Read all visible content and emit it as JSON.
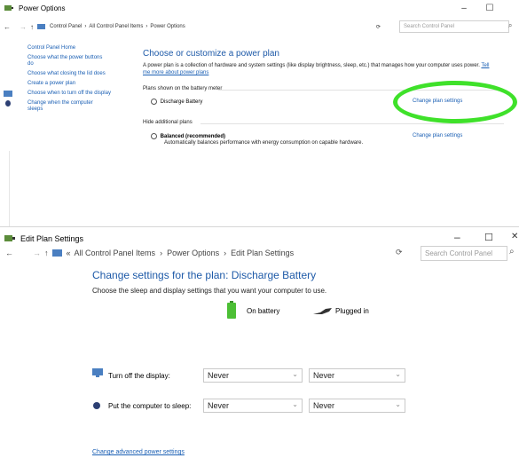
{
  "window1": {
    "title": "Power Options",
    "controls": {
      "minimize": "–",
      "maximize": "☐"
    },
    "nav": {
      "back": "←",
      "forward": "→",
      "up": "↑"
    },
    "breadcrumb": [
      "Control Panel",
      "All Control Panel Items",
      "Power Options"
    ],
    "sep": "›",
    "search_placeholder": "Search Control Panel",
    "left_nav": [
      "Control Panel Home",
      "Choose what the power buttons do",
      "Choose what closing the lid does",
      "Create a power plan",
      "Choose when to turn off the display",
      "Change when the computer sleeps"
    ],
    "heading": "Choose or customize a power plan",
    "description": "A power plan is a collection of hardware and system settings (like display brightness, sleep, etc.) that manages how your computer uses power.",
    "description_link": "Tell me more about power plans",
    "section_label": "Plans shown on the battery meter",
    "plan1_name": "Discharge Battery",
    "plan1_link": "Change plan settings",
    "hide_label": "Hide additional plans",
    "plan2_name": "Balanced (recommended)",
    "plan2_desc": "Automatically balances performance with energy consumption on capable hardware.",
    "plan2_link": "Change plan settings"
  },
  "window2": {
    "title": "Edit Plan Settings",
    "controls": {
      "minimize": "–",
      "maximize": "☐",
      "close": "✕"
    },
    "breadcrumb": [
      "All Control Panel Items",
      "Power Options",
      "Edit Plan Settings"
    ],
    "search_placeholder": "Search Control Panel",
    "heading": "Change settings for the plan: Discharge Battery",
    "subheading": "Choose the sleep and display settings that you want your computer to use.",
    "col_on_battery": "On battery",
    "col_plugged_in": "Plugged in",
    "row1_label": "Turn off the display:",
    "row1_battery": "Never",
    "row1_plugged": "Never",
    "row2_label": "Put the computer to sleep:",
    "row2_battery": "Never",
    "row2_plugged": "Never",
    "advanced_link": "Change advanced power settings"
  },
  "colors": {
    "highlight": "#3fe12a",
    "link": "#1a5fb4",
    "heading": "#1e5aa8"
  }
}
